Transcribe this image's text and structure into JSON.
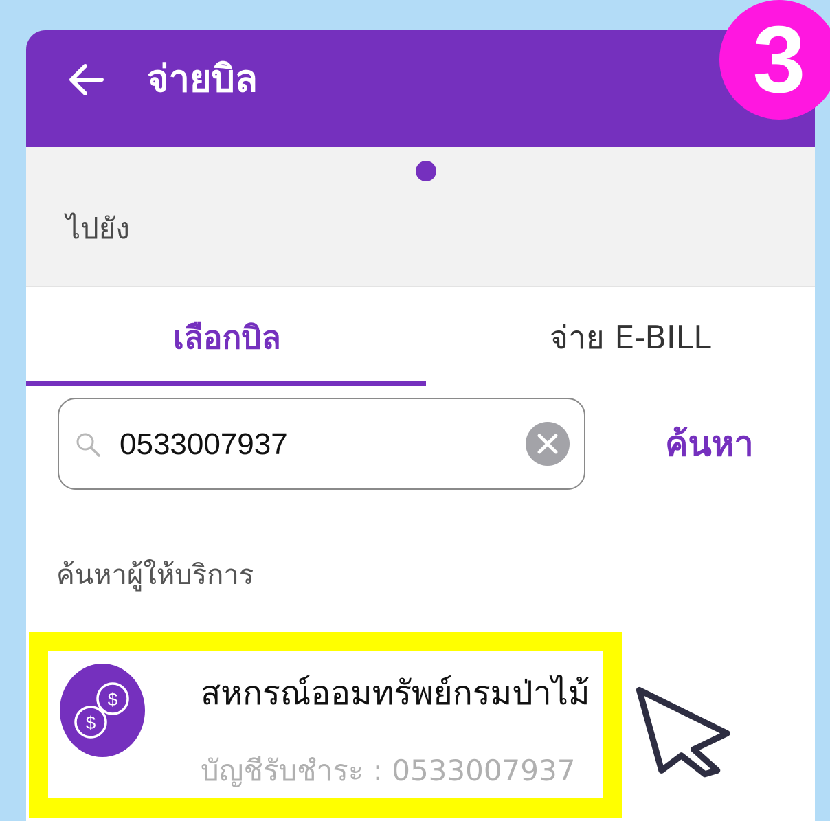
{
  "header": {
    "title": "จ่ายบิล",
    "step_number": "3"
  },
  "destination": {
    "label": "ไปยัง"
  },
  "tabs": [
    {
      "label": "เลือกบิล",
      "selected": true
    },
    {
      "label": "จ่าย E-BILL",
      "selected": false
    }
  ],
  "search": {
    "value": "0533007937",
    "button_label": "ค้นหา"
  },
  "results": {
    "section_label": "ค้นหาผู้ให้บริการ",
    "items": [
      {
        "name": "สหกรณ์ออมทรัพย์กรมป่าไม้",
        "account": "บัญชีรับชำระ : 0533007937"
      }
    ]
  },
  "colors": {
    "brand_purple": "#7530be",
    "badge_magenta": "#ff17e0",
    "highlight_yellow": "#ffff00",
    "background_blue": "#b3dcf7"
  }
}
